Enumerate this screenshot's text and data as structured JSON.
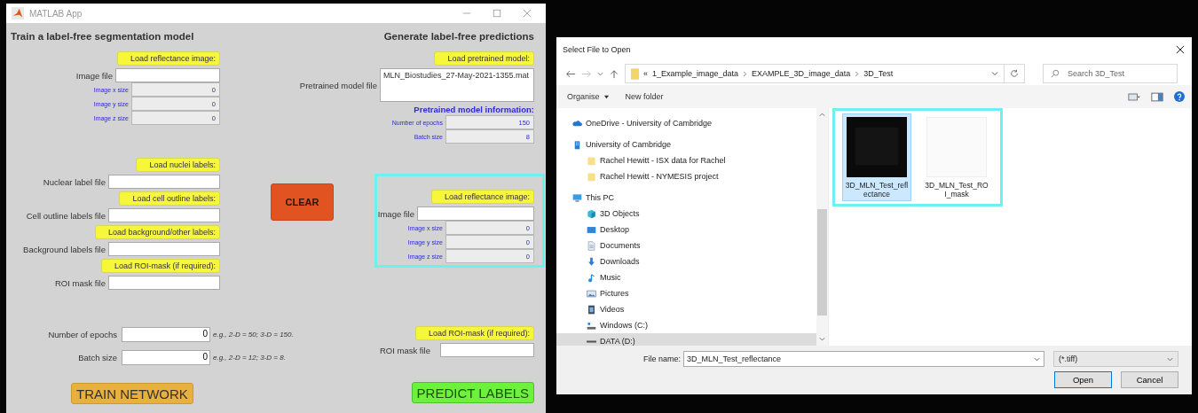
{
  "matlab_window": {
    "title": "MATLAB App"
  },
  "train_panel": {
    "title": "Train a label-free segmentation model",
    "image": {
      "load_button": "Load reflectance image:",
      "file_label": "Image file",
      "sizes": [
        {
          "label": "Image x size",
          "value": "0"
        },
        {
          "label": "Image y size",
          "value": "0"
        },
        {
          "label": "Image z size",
          "value": "0"
        }
      ]
    },
    "label_files": [
      {
        "load_button": "Load nuclei labels:",
        "file_label": "Nuclear label file"
      },
      {
        "load_button": "Load cell outline labels:",
        "file_label": "Cell outline labels file"
      },
      {
        "load_button": "Load background/other labels:",
        "file_label": "Background labels file"
      },
      {
        "load_button": "Load ROI-mask (if required):",
        "file_label": "ROI mask file"
      }
    ],
    "parameters": [
      {
        "label": "Number of epochs",
        "value": "0",
        "hint": "e.g., 2-D = 50; 3-D = 150."
      },
      {
        "label": "Batch size",
        "value": "0",
        "hint": "e.g., 2-D = 12; 3-D = 8."
      }
    ],
    "train_button": "TRAIN NETWORK"
  },
  "clear_button": "CLEAR",
  "predict_panel": {
    "title": "Generate label-free predictions",
    "load_model_button": "Load pretrained model:",
    "model_file_label": "Pretrained model file",
    "model_file_value": "MLN_Biostudies_27-May-2021-1355.mat",
    "info_title": "Pretrained model information:",
    "info": [
      {
        "label": "Number of epochs",
        "value": "150"
      },
      {
        "label": "Batch size",
        "value": "8"
      }
    ],
    "image": {
      "highlighted": true,
      "load_button": "Load reflectance image:",
      "file_label": "Image file",
      "sizes": [
        {
          "label": "Image x size",
          "value": "0"
        },
        {
          "label": "Image y size",
          "value": "0"
        },
        {
          "label": "Image z size",
          "value": "0"
        }
      ]
    },
    "roi": {
      "load_button": "Load ROI-mask (if required):",
      "file_label": "ROI mask file"
    },
    "predict_button": "PREDICT LABELS"
  },
  "file_dialog": {
    "title": "Select File to Open",
    "path": {
      "overflow": "«",
      "folders": [
        "1_Example_image_data",
        "EXAMPLE_3D_image_data",
        "3D_Test"
      ]
    },
    "search": {
      "placeholder": "Search 3D_Test"
    },
    "toolbar": {
      "organise": "Organise",
      "new_folder": "New folder"
    },
    "navigation": [
      {
        "label": "OneDrive - University of Cambridge",
        "kind": "cloud",
        "selected": false
      },
      {
        "label": "University of Cambridge",
        "kind": "building",
        "selected": false,
        "children": [
          {
            "label": "Rachel Hewitt - ISX data for Rachel",
            "kind": "folder",
            "selected": false
          },
          {
            "label": "Rachel Hewitt - NYMESIS project",
            "kind": "folder",
            "selected": false
          }
        ]
      },
      {
        "label": "This PC",
        "kind": "computer",
        "selected": false,
        "children": [
          {
            "label": "3D Objects",
            "kind": "cube",
            "selected": false
          },
          {
            "label": "Desktop",
            "kind": "desktop",
            "selected": false
          },
          {
            "label": "Documents",
            "kind": "document",
            "selected": false
          },
          {
            "label": "Downloads",
            "kind": "download",
            "selected": false
          },
          {
            "label": "Music",
            "kind": "music",
            "selected": false
          },
          {
            "label": "Pictures",
            "kind": "pictures",
            "selected": false
          },
          {
            "label": "Videos",
            "kind": "videos",
            "selected": false
          },
          {
            "label": "Windows (C:)",
            "kind": "system-drive",
            "selected": false
          },
          {
            "label": "DATA (D:)",
            "kind": "drive",
            "selected": true
          }
        ]
      }
    ],
    "files": {
      "highlighted": true,
      "items": [
        {
          "name": "3D_MLN_Test_reflectance",
          "kind": "dark",
          "selected": true
        },
        {
          "name": "3D_MLN_Test_ROI_mask",
          "kind": "light",
          "selected": false
        }
      ]
    },
    "file_name_label": "File name:",
    "file_name_value": "3D_MLN_Test_reflectance",
    "file_type": "(*.tiff)",
    "open_button": "Open",
    "cancel_button": "Cancel"
  }
}
